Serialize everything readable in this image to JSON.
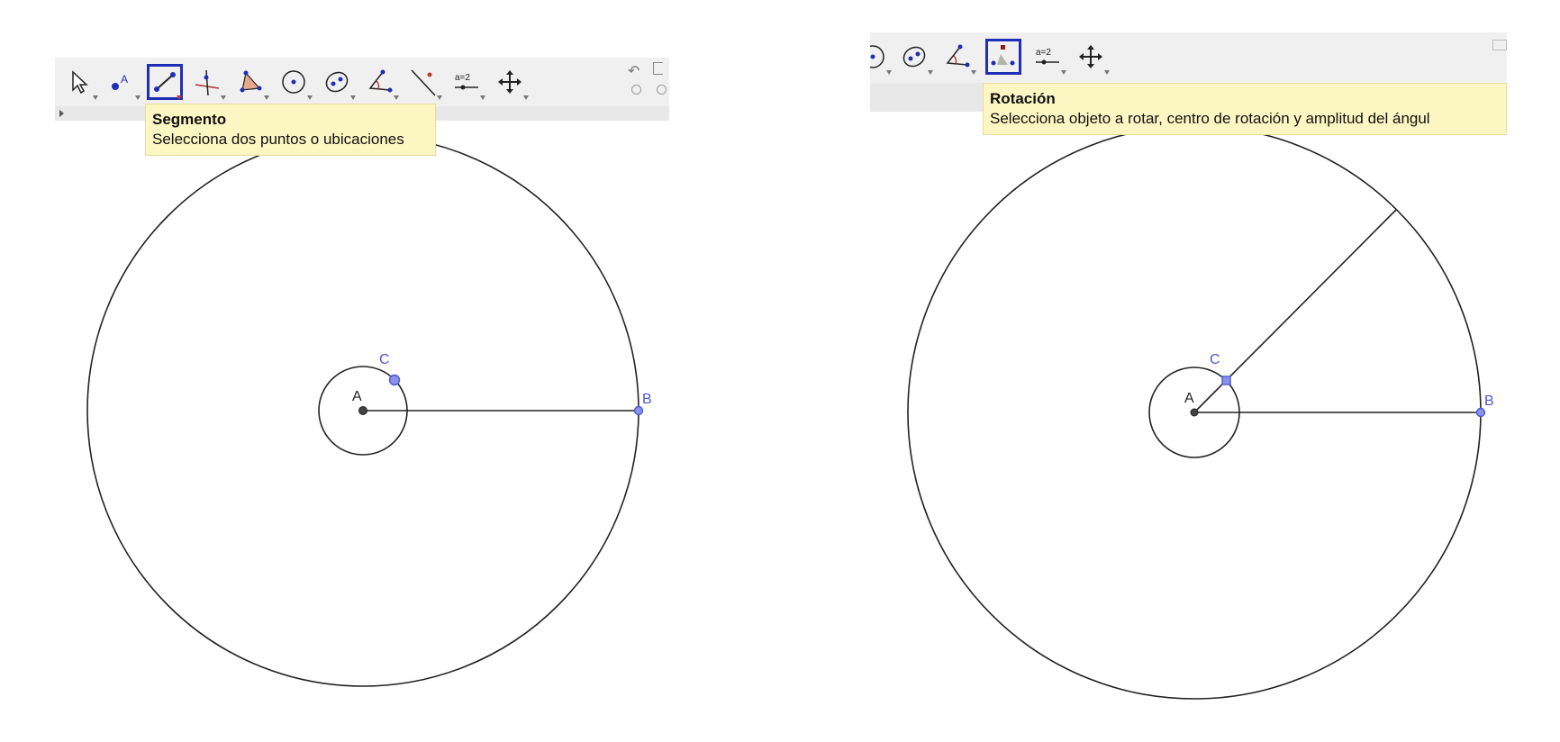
{
  "left_panel": {
    "tooltip": {
      "title": "Segmento",
      "description": "Selecciona dos puntos o ubicaciones"
    },
    "active_tool": "segment-tool",
    "tools": [
      "move-tool",
      "point-tool",
      "segment-tool",
      "perpendicular-tool",
      "polygon-tool",
      "circle-center-tool",
      "ellipse-tool",
      "angle-tool",
      "reflect-tool",
      "slider-tool",
      "move-view-tool"
    ],
    "points": {
      "a": "A",
      "b": "B",
      "c": "C"
    },
    "side_buttons": {
      "undo": "↶",
      "redo": "⟲"
    },
    "slider_icon_text": "a=2"
  },
  "right_panel": {
    "tooltip": {
      "title": "Rotación",
      "description": "Selecciona objeto a rotar, centro de rotación y amplitud del ángul"
    },
    "active_tool": "rotate-tool",
    "tools": [
      "circle-center-tool",
      "ellipse-tool",
      "angle-tool",
      "rotate-tool",
      "slider-tool",
      "move-view-tool"
    ],
    "points": {
      "a": "A",
      "b": "B",
      "c": "C"
    },
    "slider_icon_text": "a=2"
  },
  "colors": {
    "active_tool_border": "#1f2fb5",
    "tooltip_bg": "#fcf7c2",
    "point_blue": "#4b57d6",
    "point_fill": "#8a93e8"
  }
}
